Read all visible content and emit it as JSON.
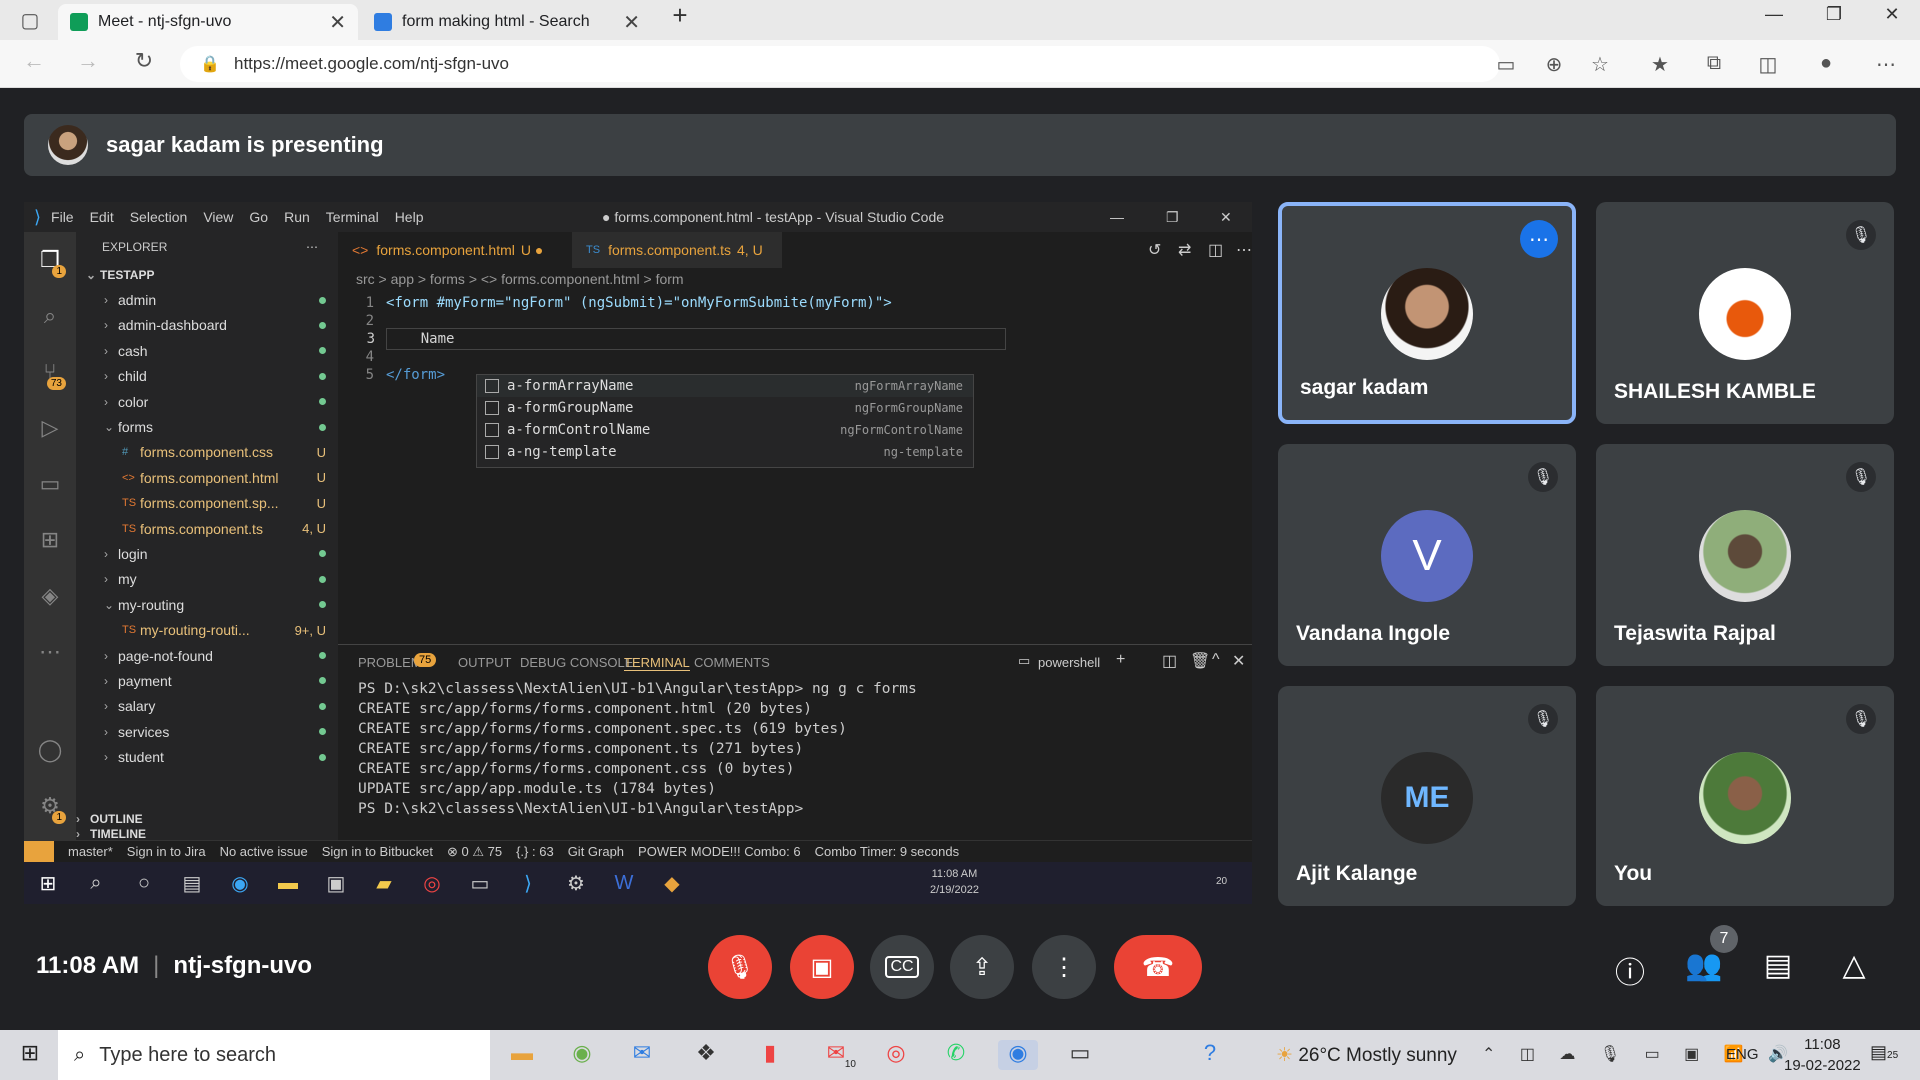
{
  "browser": {
    "tabs": [
      {
        "title": "Meet - ntj-sfgn-uvo",
        "active": true
      },
      {
        "title": "form making html - Search",
        "active": false
      }
    ],
    "url": "https://meet.google.com/ntj-sfgn-uvo"
  },
  "meet": {
    "presenting_text": "sagar kadam is presenting",
    "time": "11:08 AM",
    "meeting_code": "ntj-sfgn-uvo",
    "participant_count": "7",
    "participants": [
      {
        "name": "sagar kadam",
        "initial": "",
        "muted": false,
        "active_speaker": true
      },
      {
        "name": "SHAILESH KAMBLE",
        "initial": "",
        "muted": true
      },
      {
        "name": "Vandana Ingole",
        "initial": "V",
        "muted": true,
        "avatar_color": "#5c6bc0"
      },
      {
        "name": "Tejaswita Rajpal",
        "initial": "",
        "muted": true
      },
      {
        "name": "Ajit Kalange",
        "initial": "ME",
        "muted": true
      },
      {
        "name": "You",
        "initial": "",
        "muted": true
      }
    ],
    "accent_color": "#8ab4f8",
    "danger_color": "#ea4335"
  },
  "vscode": {
    "window_title": "● forms.component.html - testApp - Visual Studio Code",
    "menu": [
      "File",
      "Edit",
      "Selection",
      "View",
      "Go",
      "Run",
      "Terminal",
      "Help"
    ],
    "explorer_label": "EXPLORER",
    "project": "TESTAPP",
    "activity_badges": {
      "explorer": "1",
      "scm": "73",
      "settings": "1"
    },
    "tree": [
      {
        "label": "admin",
        "type": "folder",
        "open": false,
        "depth": 1,
        "tag": ""
      },
      {
        "label": "admin-dashboard",
        "type": "folder",
        "open": false,
        "depth": 1,
        "tag": ""
      },
      {
        "label": "cash",
        "type": "folder",
        "open": false,
        "depth": 1,
        "tag": ""
      },
      {
        "label": "child",
        "type": "folder",
        "open": false,
        "depth": 1,
        "tag": ""
      },
      {
        "label": "color",
        "type": "folder",
        "open": false,
        "depth": 1,
        "tag": ""
      },
      {
        "label": "forms",
        "type": "folder",
        "open": true,
        "depth": 1,
        "tag": ""
      },
      {
        "label": "forms.component.css",
        "type": "css",
        "depth": 2,
        "tag": "U"
      },
      {
        "label": "forms.component.html",
        "type": "html",
        "depth": 2,
        "tag": "U"
      },
      {
        "label": "forms.component.sp...",
        "type": "ts",
        "depth": 2,
        "tag": "U"
      },
      {
        "label": "forms.component.ts",
        "type": "ts",
        "depth": 2,
        "tag": "4, U"
      },
      {
        "label": "login",
        "type": "folder",
        "open": false,
        "depth": 1,
        "tag": ""
      },
      {
        "label": "my",
        "type": "folder",
        "open": false,
        "depth": 1,
        "tag": ""
      },
      {
        "label": "my-routing",
        "type": "folder",
        "open": true,
        "depth": 1,
        "tag": ""
      },
      {
        "label": "my-routing-routi...",
        "type": "ts",
        "depth": 2,
        "tag": "9+, U"
      },
      {
        "label": "page-not-found",
        "type": "folder",
        "open": false,
        "depth": 1,
        "tag": ""
      },
      {
        "label": "payment",
        "type": "folder",
        "open": false,
        "depth": 1,
        "tag": ""
      },
      {
        "label": "salary",
        "type": "folder",
        "open": false,
        "depth": 1,
        "tag": ""
      },
      {
        "label": "services",
        "type": "folder",
        "open": false,
        "depth": 1,
        "tag": ""
      },
      {
        "label": "student",
        "type": "folder",
        "open": false,
        "depth": 1,
        "tag": ""
      }
    ],
    "outline_label": "OUTLINE",
    "timeline_label": "TIMELINE",
    "editor_tabs": [
      {
        "label": "forms.component.html",
        "prefix": "<>",
        "suffix": "U ●"
      },
      {
        "label": "forms.component.ts",
        "prefix": "TS",
        "suffix": "4, U"
      }
    ],
    "breadcrumb": "src > app > forms > <> forms.component.html > form",
    "code_lines": [
      {
        "n": "1",
        "text": "<form #myForm=\"ngForm\" (ngSubmit)=\"onMyFormSubmite(myForm)\">"
      },
      {
        "n": "2",
        "text": ""
      },
      {
        "n": "3",
        "text": "    Name"
      },
      {
        "n": "4",
        "text": ""
      },
      {
        "n": "5",
        "text": "</form>"
      }
    ],
    "suggestions": [
      {
        "label": "a-formArrayName",
        "detail": "ngFormArrayName"
      },
      {
        "label": "a-formGroupName",
        "detail": "ngFormGroupName"
      },
      {
        "label": "a-formControlName",
        "detail": "ngFormControlName"
      },
      {
        "label": "a-ng-template",
        "detail": "ng-template"
      }
    ],
    "panel_tabs": [
      "PROBLEMS",
      "OUTPUT",
      "DEBUG CONSOLE",
      "TERMINAL",
      "COMMENTS"
    ],
    "problems_count": "75",
    "shell": "powershell",
    "terminal_lines": [
      "PS D:\\sk2\\classess\\NextAlien\\UI-b1\\Angular\\testApp> ng g c forms",
      "CREATE src/app/forms/forms.component.html (20 bytes)",
      "CREATE src/app/forms/forms.component.spec.ts (619 bytes)",
      "CREATE src/app/forms/forms.component.ts (271 bytes)",
      "CREATE src/app/forms/forms.component.css (0 bytes)",
      "UPDATE src/app/app.module.ts (1784 bytes)",
      "PS D:\\sk2\\classess\\NextAlien\\UI-b1\\Angular\\testApp> "
    ],
    "status_items": [
      "master*",
      "Sign in to Jira",
      "No active issue",
      "Sign in to Bitbucket",
      "⊗ 0 ⚠ 75",
      "{.} : 63",
      "Git Graph",
      "POWER MODE!!! Combo: 6",
      "Combo Timer: 9 seconds"
    ],
    "inner_taskbar_time": "11:08 AM",
    "inner_taskbar_date": "2/19/2022",
    "inner_notif": "20"
  },
  "taskbar": {
    "search_placeholder": "Type here to search",
    "weather": "26°C  Mostly sunny",
    "lang": "ENG",
    "time": "11:08",
    "date": "19-02-2022",
    "notif_count": "25",
    "mail_badge": "10"
  }
}
